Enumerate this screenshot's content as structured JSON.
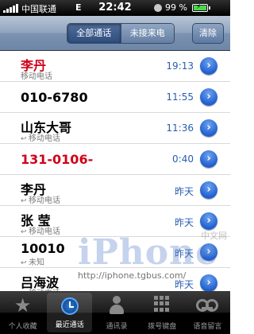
{
  "status": {
    "carrier": "中国联通",
    "network": "E",
    "time": "22:42",
    "battery": "99 %",
    "battery_level": 0.99
  },
  "nav": {
    "segment_all": "全部通话",
    "segment_missed": "未接来电",
    "clear": "清除"
  },
  "calls": [
    {
      "name": "李丹",
      "type": "移动电话",
      "time": "19:13",
      "missed": true
    },
    {
      "name": "010-6780",
      "type": "",
      "time": "11:55",
      "missed": false
    },
    {
      "name": "山东大哥",
      "type": "移动电话",
      "time": "11:36",
      "missed": false
    },
    {
      "name": "131-0106-",
      "type": "",
      "time": "0:40",
      "missed": true
    },
    {
      "name": "李丹",
      "type": "移动电话",
      "time": "昨天",
      "missed": false
    },
    {
      "name": "张 莹",
      "type": "移动电话",
      "time": "昨天",
      "missed": false
    },
    {
      "name": "10010",
      "type": "未知",
      "time": "昨天",
      "missed": false
    },
    {
      "name": "吕海波",
      "type": "移动电话",
      "time": "昨天",
      "missed": false
    }
  ],
  "watermark": {
    "brand": "iPhone",
    "cn": "中文网",
    "url": "http://iphone.tgbus.com/"
  },
  "tabs": {
    "favorites": "个人收藏",
    "recents": "最近通话",
    "contacts": "通讯录",
    "keypad": "拨号键盘",
    "voicemail": "语音留言"
  },
  "colors": {
    "missed_red": "#d0021b",
    "time_blue": "#2a5db0"
  }
}
